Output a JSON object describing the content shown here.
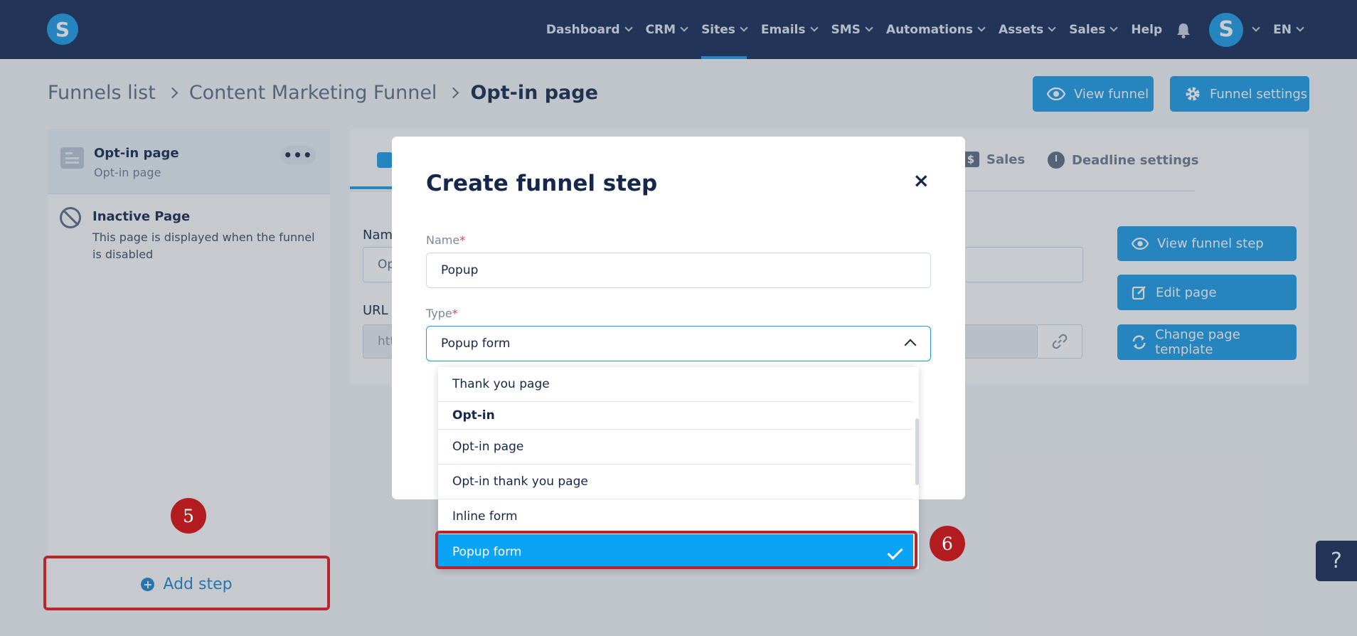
{
  "navbar": {
    "logo": "S",
    "items": [
      {
        "label": "Dashboard"
      },
      {
        "label": "CRM"
      },
      {
        "label": "Sites"
      },
      {
        "label": "Emails"
      },
      {
        "label": "SMS"
      },
      {
        "label": "Automations"
      },
      {
        "label": "Assets"
      },
      {
        "label": "Sales"
      }
    ],
    "help": "Help",
    "avatar": "S",
    "language": "EN"
  },
  "breadcrumb": {
    "root": "Funnels list",
    "funnel": "Content Marketing Funnel",
    "current": "Opt-in page"
  },
  "header_buttons": {
    "view_funnel": "View funnel",
    "funnel_settings": "Funnel settings"
  },
  "sidebar": {
    "step_title": "Opt-in page",
    "step_subtitle": "Opt-in page",
    "menu_dots": "•••",
    "inactive_title": "Inactive Page",
    "inactive_desc": "This page is displayed when the funnel is disabled",
    "add_step": "Add step"
  },
  "main": {
    "tabs": {
      "sales": "Sales",
      "deadline": "Deadline settings",
      "sales_icon": "$"
    },
    "name_label": "Nam",
    "name_value": "Op",
    "url_label": "URL",
    "url_value": "htt",
    "buttons": {
      "view_step": "View funnel step",
      "edit_page": "Edit page",
      "change_template": "Change page template"
    }
  },
  "modal": {
    "title": "Create funnel step",
    "close": "×",
    "name_label": "Name",
    "required_mark": "*",
    "name_value": "Popup",
    "type_label": "Type",
    "type_value": "Popup form"
  },
  "dropdown": {
    "items": [
      {
        "label": "Thank you page"
      },
      {
        "label": "Opt-in"
      },
      {
        "label": "Opt-in page"
      },
      {
        "label": "Opt-in thank you page"
      },
      {
        "label": "Inline form"
      },
      {
        "label": "Popup form"
      }
    ]
  },
  "annotations": {
    "step5": "5",
    "step6": "6"
  },
  "help_button": "?",
  "colors": {
    "navbar": "#142a55",
    "accent": "#1a9ae6",
    "selected_option": "#0ba3f3",
    "annotation_red": "#b31d22"
  },
  "icons": [
    "eye-icon",
    "gear-icon",
    "bell-icon",
    "plus-circle-icon",
    "edit-icon",
    "refresh-icon",
    "link-icon",
    "ban-icon",
    "check-icon",
    "chevron-up-icon",
    "close-icon"
  ]
}
